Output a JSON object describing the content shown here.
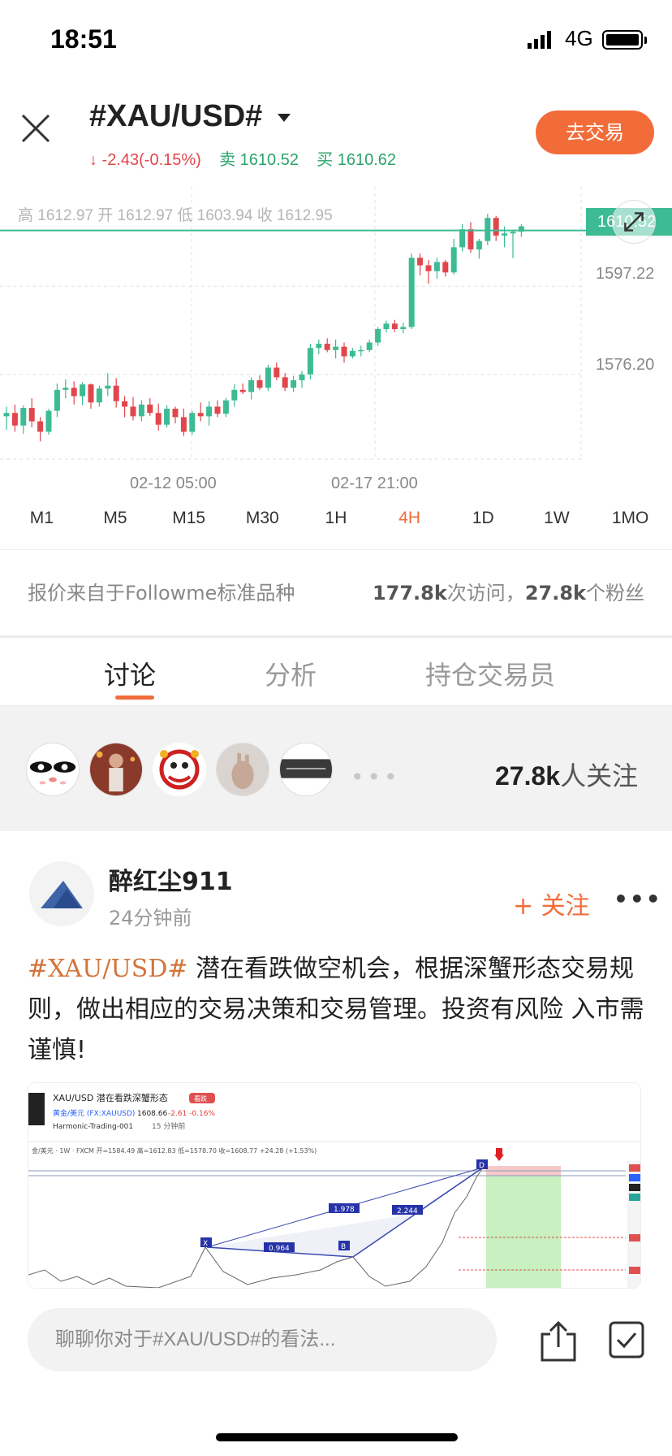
{
  "status_bar": {
    "time": "18:51",
    "network": "4G"
  },
  "header": {
    "symbol": "#XAU/USD#",
    "change": "↓ -2.43(-0.15%)",
    "sell_label": "卖",
    "sell_price": "1610.52",
    "buy_label": "买",
    "buy_price": "1610.62",
    "trade_button": "去交易"
  },
  "chart": {
    "ohlc": "高 1612.97   开 1612.97   低 1603.94   收 1612.95",
    "last_price": "1610.52",
    "y_labels": [
      "1597.22",
      "1576.20"
    ],
    "x_labels": [
      "02-12 05:00",
      "02-17 21:00"
    ],
    "up_color": "#3dbb94",
    "down_color": "#e0464b"
  },
  "chart_data": {
    "type": "candlestick",
    "series": [
      {
        "values": [
          [
            1566.2,
            1568.5,
            1563.0,
            1567.0
          ],
          [
            1567.0,
            1569.0,
            1562.5,
            1564.0
          ],
          [
            1564.0,
            1568.8,
            1562.0,
            1568.2
          ],
          [
            1568.2,
            1570.5,
            1563.6,
            1565.0
          ],
          [
            1565.0,
            1566.0,
            1560.2,
            1562.5
          ],
          [
            1562.5,
            1568.0,
            1561.8,
            1567.5
          ],
          [
            1567.5,
            1574.0,
            1566.0,
            1572.5
          ],
          [
            1572.5,
            1575.0,
            1570.5,
            1573.0
          ],
          [
            1573.0,
            1574.5,
            1569.0,
            1571.0
          ],
          [
            1571.0,
            1574.3,
            1568.8,
            1573.8
          ],
          [
            1573.8,
            1574.0,
            1568.0,
            1569.5
          ],
          [
            1569.5,
            1573.5,
            1568.5,
            1572.8
          ],
          [
            1572.8,
            1576.5,
            1571.0,
            1573.5
          ],
          [
            1573.5,
            1575.3,
            1568.3,
            1569.8
          ],
          [
            1569.8,
            1571.0,
            1566.0,
            1568.5
          ],
          [
            1568.5,
            1570.8,
            1565.2,
            1566.2
          ],
          [
            1566.2,
            1570.0,
            1565.0,
            1569.0
          ],
          [
            1569.0,
            1570.5,
            1566.3,
            1567.0
          ],
          [
            1567.0,
            1569.2,
            1562.8,
            1564.2
          ],
          [
            1564.2,
            1568.8,
            1563.5,
            1568.0
          ],
          [
            1568.0,
            1568.5,
            1564.5,
            1566.0
          ],
          [
            1566.0,
            1568.0,
            1561.5,
            1562.5
          ],
          [
            1562.5,
            1567.5,
            1561.8,
            1567.0
          ],
          [
            1567.0,
            1569.5,
            1565.0,
            1566.2
          ],
          [
            1566.2,
            1569.8,
            1564.0,
            1568.5
          ],
          [
            1568.5,
            1570.0,
            1566.0,
            1566.8
          ],
          [
            1566.8,
            1570.6,
            1566.0,
            1570.0
          ],
          [
            1570.0,
            1573.8,
            1568.5,
            1572.5
          ],
          [
            1572.5,
            1574.0,
            1571.5,
            1572.0
          ],
          [
            1572.0,
            1575.5,
            1570.2,
            1574.8
          ],
          [
            1574.8,
            1576.0,
            1572.5,
            1573.0
          ],
          [
            1573.0,
            1578.5,
            1572.3,
            1577.8
          ],
          [
            1577.8,
            1579.0,
            1574.8,
            1575.5
          ],
          [
            1575.5,
            1576.5,
            1572.2,
            1573.0
          ],
          [
            1573.0,
            1575.8,
            1572.0,
            1574.8
          ],
          [
            1574.8,
            1577.0,
            1573.0,
            1576.2
          ],
          [
            1576.2,
            1583.5,
            1575.0,
            1582.5
          ],
          [
            1582.5,
            1584.5,
            1581.0,
            1583.5
          ],
          [
            1583.5,
            1584.8,
            1581.5,
            1582.0
          ],
          [
            1582.0,
            1584.5,
            1580.0,
            1582.8
          ],
          [
            1582.8,
            1583.8,
            1579.0,
            1580.5
          ],
          [
            1580.5,
            1582.5,
            1580.0,
            1581.8
          ],
          [
            1581.8,
            1583.0,
            1580.5,
            1582.0
          ],
          [
            1582.0,
            1584.5,
            1581.5,
            1583.8
          ],
          [
            1583.8,
            1587.5,
            1583.0,
            1587.0
          ],
          [
            1587.0,
            1589.0,
            1586.2,
            1588.3
          ],
          [
            1588.3,
            1589.2,
            1586.3,
            1587.0
          ],
          [
            1587.0,
            1588.5,
            1586.0,
            1587.5
          ],
          [
            1587.5,
            1605.0,
            1587.0,
            1604.0
          ],
          [
            1604.0,
            1605.0,
            1599.8,
            1602.2
          ],
          [
            1602.2,
            1603.5,
            1597.8,
            1600.8
          ],
          [
            1600.8,
            1604.0,
            1599.0,
            1603.0
          ],
          [
            1603.0,
            1603.5,
            1599.5,
            1600.5
          ],
          [
            1600.5,
            1608.5,
            1600.0,
            1606.5
          ],
          [
            1606.5,
            1612.0,
            1605.5,
            1610.8
          ],
          [
            1610.8,
            1612.5,
            1605.2,
            1606.0
          ],
          [
            1606.0,
            1608.5,
            1603.8,
            1608.0
          ],
          [
            1608.0,
            1614.5,
            1607.0,
            1613.5
          ],
          [
            1613.5,
            1614.0,
            1608.0,
            1609.3
          ],
          [
            1609.3,
            1611.5,
            1606.5,
            1609.8
          ],
          [
            1609.8,
            1610.5,
            1603.9,
            1610.2
          ],
          [
            1610.2,
            1612.0,
            1609.0,
            1611.5
          ]
        ]
      }
    ],
    "y_ticks": [
      "1597.22",
      "1576.20"
    ],
    "x_ticks": [
      "02-12 05:00",
      "02-17 21:00"
    ],
    "last_price": 1610.52
  },
  "timeframes": [
    "M1",
    "M5",
    "M15",
    "M30",
    "1H",
    "4H",
    "1D",
    "1W",
    "1MO"
  ],
  "info": {
    "source": "报价来自于Followme标准品种",
    "visits_num": "177.8k",
    "visits_label": "次访问，",
    "fans_num": "27.8k",
    "fans_label": "个粉丝"
  },
  "tabs": [
    "讨论",
    "分析",
    "持仓交易员"
  ],
  "followers": {
    "count": "27.8k",
    "label": "人关注",
    "more": "•••"
  },
  "post": {
    "author": "醉红尘911",
    "time": "24分钟前",
    "follow": "+ 关注",
    "more": "•••",
    "tag": "#XAU/USD#",
    "text": " 潜在看跌做空机会，根据深蟹形态交易规则，做出相应的交易决策和交易管理。投资有风险 入市需谨慎!",
    "image": {
      "title": "XAU/USD 潜在看跌深蟹形态",
      "badge": "看跌",
      "instrument": "黄金/美元 (FX:XAUUSD)",
      "price": "1608.66",
      "change": "-2.61 -0.16%",
      "author": "Harmonic-Trading-001",
      "time_ago": "15 分钟前",
      "toolbar": "金/美元 · 1W · FXCM  开=1584.49  高=1612.83  低=1578.70  收=1608.77 +24.28 (+1.53%)",
      "labels": [
        "X",
        "B",
        "D"
      ],
      "ratios": [
        "0.964",
        "1.978",
        "2.244"
      ]
    }
  },
  "composer": {
    "placeholder": "聊聊你对于#XAU/USD#的看法..."
  }
}
